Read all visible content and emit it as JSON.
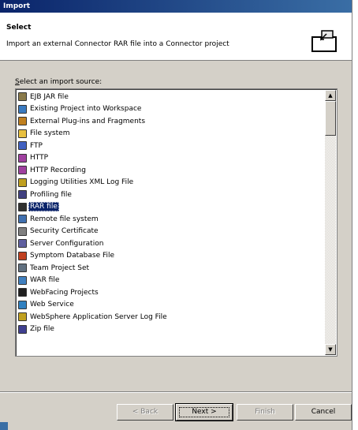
{
  "window": {
    "title": "Import"
  },
  "header": {
    "title": "Select",
    "description": "Import an external Connector RAR file into a Connector project",
    "banner_icon": "import-wizard-icon"
  },
  "source_label": {
    "prefix": "S",
    "rest": "elect an import source:"
  },
  "sources": [
    {
      "label": "EJB JAR file",
      "icon": "jar-icon",
      "color": "#8a7a4a"
    },
    {
      "label": "Existing Project into Workspace",
      "icon": "project-icon",
      "color": "#3a7ac0"
    },
    {
      "label": "External Plug-ins and Fragments",
      "icon": "plugin-icon",
      "color": "#c08020"
    },
    {
      "label": "File system",
      "icon": "folder-icon",
      "color": "#e8c040"
    },
    {
      "label": "FTP",
      "icon": "ftp-icon",
      "color": "#4060c0"
    },
    {
      "label": "HTTP",
      "icon": "http-icon",
      "color": "#a040a0"
    },
    {
      "label": "HTTP Recording",
      "icon": "http-recording-icon",
      "color": "#a040a0"
    },
    {
      "label": "Logging Utilities XML Log File",
      "icon": "log-file-icon",
      "color": "#c0a020"
    },
    {
      "label": "Profiling file",
      "icon": "profiling-icon",
      "color": "#404080"
    },
    {
      "label": "RAR file",
      "icon": "rar-icon",
      "color": "#303030"
    },
    {
      "label": "Remote file system",
      "icon": "remote-fs-icon",
      "color": "#4070b0"
    },
    {
      "label": "Security Certificate",
      "icon": "certificate-icon",
      "color": "#808080"
    },
    {
      "label": "Server Configuration",
      "icon": "server-config-icon",
      "color": "#6060a0"
    },
    {
      "label": "Symptom Database File",
      "icon": "database-icon",
      "color": "#c04020"
    },
    {
      "label": "Team Project Set",
      "icon": "team-project-icon",
      "color": "#607080"
    },
    {
      "label": "WAR file",
      "icon": "war-icon",
      "color": "#4080c0"
    },
    {
      "label": "WebFacing Projects",
      "icon": "webfacing-icon",
      "color": "#202020"
    },
    {
      "label": "Web Service",
      "icon": "web-service-icon",
      "color": "#3080c0"
    },
    {
      "label": "WebSphere Application Server Log File",
      "icon": "was-log-icon",
      "color": "#c0a020"
    },
    {
      "label": "Zip file",
      "icon": "zip-icon",
      "color": "#404090"
    }
  ],
  "selected_index": 9,
  "buttons": {
    "back": "< Back",
    "next": "Next >",
    "finish": "Finish",
    "cancel": "Cancel"
  }
}
